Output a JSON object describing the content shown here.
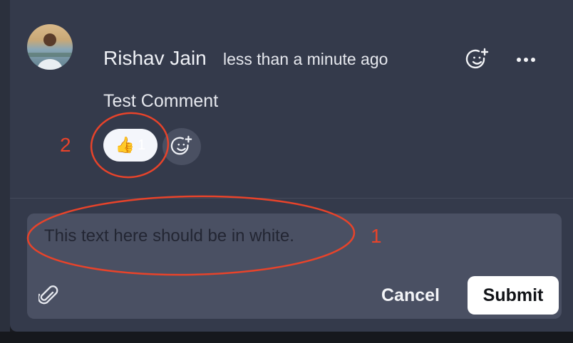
{
  "comment": {
    "author": "Rishav Jain",
    "timestamp": "less than a minute ago",
    "text": "Test Comment",
    "reaction": {
      "emoji": "👍",
      "count": "1"
    }
  },
  "editor": {
    "text": "This text here should be in white.",
    "cancel_label": "Cancel",
    "submit_label": "Submit"
  },
  "annotations": {
    "one": "1",
    "two": "2",
    "color": "#e8432a"
  },
  "icons": {
    "react": "add-reaction-smiley-icon",
    "more": "more-horizontal-icon",
    "attach": "paperclip-icon"
  },
  "colors": {
    "panel": "#343a4b",
    "editor": "#4a5063",
    "submit_bg": "#ffffff"
  }
}
